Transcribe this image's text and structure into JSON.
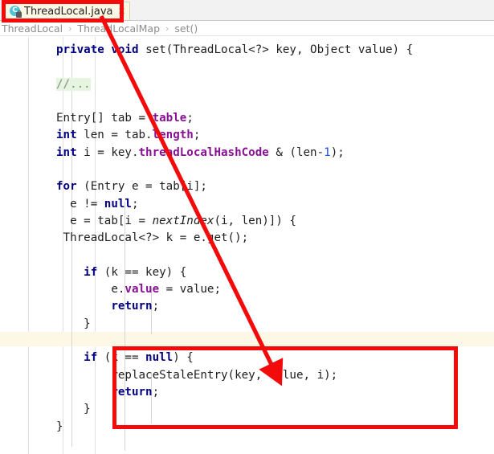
{
  "window": {
    "app": "IntelliJ IDEA Editor",
    "bg_color": "#ffffff"
  },
  "tab": {
    "label": "ThreadLocal.java",
    "icon": "java-class-icon",
    "icon_letter": "C",
    "icon_color": "#4ec3d9",
    "close_glyph": "✕",
    "active": true
  },
  "breadcrumb": {
    "separator": "›",
    "items": [
      {
        "label": "ThreadLocal"
      },
      {
        "label": "ThreadLocalMap"
      },
      {
        "label": "set()"
      }
    ]
  },
  "editor": {
    "language": "java",
    "current_line_index": 17,
    "current_line_color": "#fdf8e6",
    "code_lines": [
      {
        "indent": 0,
        "segments": [
          {
            "t": "private ",
            "c": "kw"
          },
          {
            "t": "void ",
            "c": "kw"
          },
          {
            "t": "set(ThreadLocal<?> key, Object value) {",
            "c": "pl"
          }
        ]
      },
      {
        "indent": 0,
        "segments": []
      },
      {
        "indent": 0,
        "segments": [
          {
            "t": "//...",
            "c": "cmt"
          }
        ]
      },
      {
        "indent": 0,
        "segments": []
      },
      {
        "indent": 0,
        "segments": [
          {
            "t": "Entry[] tab = ",
            "c": "pl"
          },
          {
            "t": "table",
            "c": "fld"
          },
          {
            "t": ";",
            "c": "pl"
          }
        ]
      },
      {
        "indent": 0,
        "segments": [
          {
            "t": "int ",
            "c": "kw"
          },
          {
            "t": "len = tab.",
            "c": "pl"
          },
          {
            "t": "length",
            "c": "fld"
          },
          {
            "t": ";",
            "c": "pl"
          }
        ]
      },
      {
        "indent": 0,
        "segments": [
          {
            "t": "int ",
            "c": "kw"
          },
          {
            "t": "i = key.",
            "c": "pl"
          },
          {
            "t": "threadLocalHashCode",
            "c": "fld"
          },
          {
            "t": " & (len-",
            "c": "pl"
          },
          {
            "t": "1",
            "c": "num"
          },
          {
            "t": ");",
            "c": "pl"
          }
        ]
      },
      {
        "indent": 0,
        "segments": []
      },
      {
        "indent": 0,
        "segments": [
          {
            "t": "for ",
            "c": "kw"
          },
          {
            "t": "(Entry e = tab[i];",
            "c": "pl"
          }
        ]
      },
      {
        "indent": 0,
        "segments": [
          {
            "t": "  e != ",
            "c": "pl"
          },
          {
            "t": "null",
            "c": "kw"
          },
          {
            "t": ";",
            "c": "pl"
          }
        ]
      },
      {
        "indent": 0,
        "segments": [
          {
            "t": "  e = tab[i = ",
            "c": "pl"
          },
          {
            "t": "nextIndex",
            "c": "ital"
          },
          {
            "t": "(i, len)]) {",
            "c": "pl"
          }
        ]
      },
      {
        "indent": 0,
        "segments": [
          {
            "t": " ThreadLocal<?> k = e.get();",
            "c": "pl"
          }
        ]
      },
      {
        "indent": 0,
        "segments": []
      },
      {
        "indent": 0,
        "segments": [
          {
            "t": "    ",
            "c": "pl"
          },
          {
            "t": "if ",
            "c": "kw"
          },
          {
            "t": "(k == key) {",
            "c": "pl"
          }
        ]
      },
      {
        "indent": 0,
        "segments": [
          {
            "t": "        e.",
            "c": "pl"
          },
          {
            "t": "value",
            "c": "fld"
          },
          {
            "t": " = value;",
            "c": "pl"
          }
        ]
      },
      {
        "indent": 0,
        "segments": [
          {
            "t": "        ",
            "c": "pl"
          },
          {
            "t": "return",
            "c": "kw"
          },
          {
            "t": ";",
            "c": "pl"
          }
        ]
      },
      {
        "indent": 0,
        "segments": [
          {
            "t": "    }",
            "c": "pl"
          }
        ]
      },
      {
        "indent": 0,
        "segments": []
      },
      {
        "indent": 0,
        "segments": [
          {
            "t": "    ",
            "c": "pl"
          },
          {
            "t": "if ",
            "c": "kw"
          },
          {
            "t": "(k == ",
            "c": "pl"
          },
          {
            "t": "null",
            "c": "kw"
          },
          {
            "t": ") {",
            "c": "pl"
          }
        ]
      },
      {
        "indent": 0,
        "segments": [
          {
            "t": "        replaceStaleEntry(key, value, i);",
            "c": "pl"
          }
        ]
      },
      {
        "indent": 0,
        "segments": [
          {
            "t": "        ",
            "c": "pl"
          },
          {
            "t": "return",
            "c": "kw"
          },
          {
            "t": ";",
            "c": "pl"
          }
        ]
      },
      {
        "indent": 0,
        "segments": [
          {
            "t": "    }",
            "c": "pl"
          }
        ]
      },
      {
        "indent": 0,
        "segments": [
          {
            "t": "}",
            "c": "pl"
          }
        ]
      }
    ]
  },
  "annotations": {
    "color": "#f30b0b",
    "code_box": {
      "label": "highlight-rectangle-if-k-null"
    },
    "tab_box": {
      "label": "highlight-rectangle-editor-tab"
    },
    "arrow": {
      "label": "red-arrow-tab-to-code"
    }
  }
}
